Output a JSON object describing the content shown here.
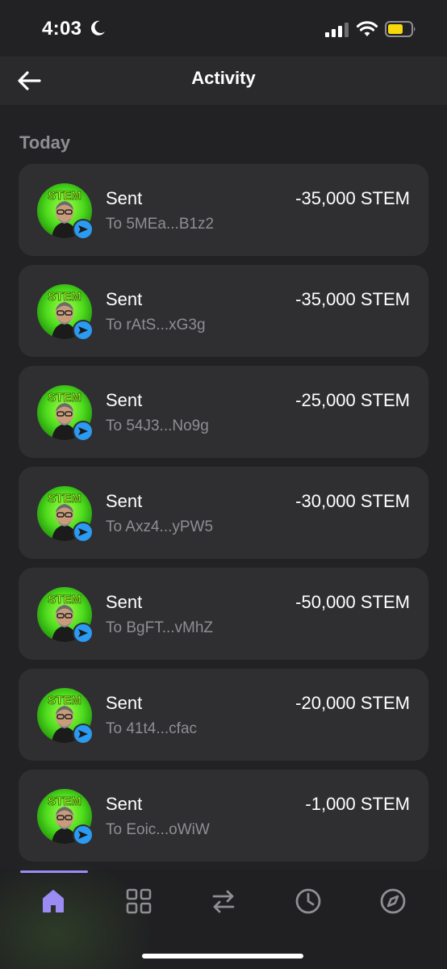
{
  "status_bar": {
    "time": "4:03",
    "moon_icon": "moon-icon",
    "signal_icon": "cellular-signal-icon",
    "wifi_icon": "wifi-icon",
    "battery_icon": "battery-icon",
    "battery_color": "#f5d90a"
  },
  "header": {
    "back_icon": "arrow-left-icon",
    "title": "Activity"
  },
  "section": {
    "label": "Today"
  },
  "token": {
    "avatar_text": "STEM",
    "badge_icon": "send-arrow-icon",
    "badge_color": "#2b9af0"
  },
  "transactions": [
    {
      "type": "Sent",
      "address": "To 5MEa...B1z2",
      "amount": "-35,000 STEM"
    },
    {
      "type": "Sent",
      "address": "To rAtS...xG3g",
      "amount": "-35,000 STEM"
    },
    {
      "type": "Sent",
      "address": "To 54J3...No9g",
      "amount": "-25,000 STEM"
    },
    {
      "type": "Sent",
      "address": "To Axz4...yPW5",
      "amount": "-30,000 STEM"
    },
    {
      "type": "Sent",
      "address": "To BgFT...vMhZ",
      "amount": "-50,000 STEM"
    },
    {
      "type": "Sent",
      "address": "To 41t4...cfac",
      "amount": "-20,000 STEM"
    },
    {
      "type": "Sent",
      "address": "To Eoic...oWiW",
      "amount": "-1,000 STEM"
    }
  ],
  "tab_bar": {
    "active_color": "#9b8cf5",
    "inactive_color": "#8e8e93",
    "tabs": [
      {
        "icon": "home-icon",
        "active": true
      },
      {
        "icon": "grid-icon",
        "active": false
      },
      {
        "icon": "swap-arrows-icon",
        "active": false
      },
      {
        "icon": "clock-icon",
        "active": false
      },
      {
        "icon": "compass-icon",
        "active": false
      }
    ]
  }
}
